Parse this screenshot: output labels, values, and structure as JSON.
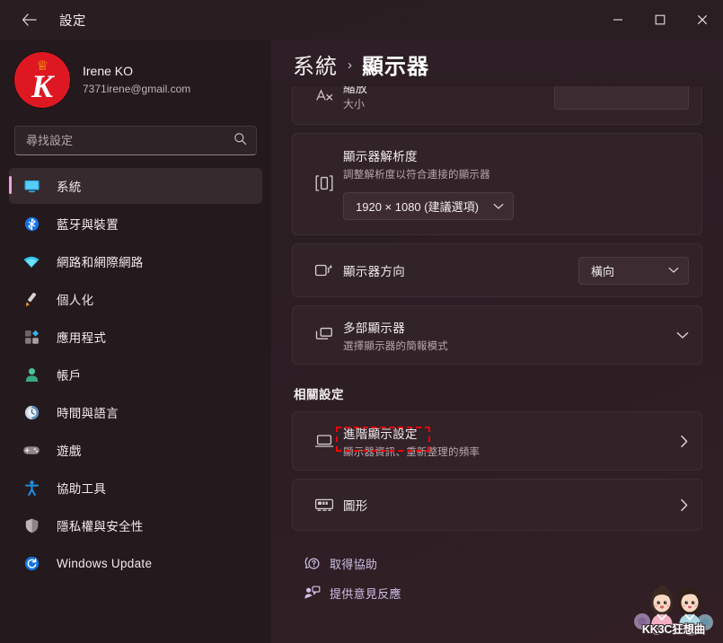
{
  "window": {
    "title": "設定",
    "back_icon": "back-arrow-icon",
    "minimize_label": "—",
    "maximize_label": "□",
    "close_label": "✕"
  },
  "profile": {
    "name": "Irene KO",
    "email": "7371irene@gmail.com",
    "avatar_letter": "K",
    "avatar_crown_icon": "crown-icon",
    "avatar_color": "#dd1822"
  },
  "search": {
    "placeholder": "尋找設定",
    "value": "",
    "icon": "search-icon"
  },
  "sidebar": {
    "accent_color": "#e8a6d8",
    "items": [
      {
        "label": "系統",
        "icon": "monitor-icon",
        "selected": true
      },
      {
        "label": "藍牙與裝置",
        "icon": "bluetooth-icon",
        "selected": false
      },
      {
        "label": "網路和網際網路",
        "icon": "wifi-icon",
        "selected": false
      },
      {
        "label": "個人化",
        "icon": "paintbrush-icon",
        "selected": false
      },
      {
        "label": "應用程式",
        "icon": "apps-grid-icon",
        "selected": false
      },
      {
        "label": "帳戶",
        "icon": "person-icon",
        "selected": false
      },
      {
        "label": "時間與語言",
        "icon": "clock-icon",
        "selected": false
      },
      {
        "label": "遊戲",
        "icon": "gamepad-icon",
        "selected": false
      },
      {
        "label": "協助工具",
        "icon": "accessibility-icon",
        "selected": false
      },
      {
        "label": "隱私權與安全性",
        "icon": "shield-icon",
        "selected": false
      },
      {
        "label": "Windows Update",
        "icon": "update-refresh-icon",
        "selected": false
      }
    ]
  },
  "breadcrumb": {
    "parent": "系統",
    "separator": "›",
    "current": "顯示器"
  },
  "main": {
    "clipped_card": {
      "title_partial": "縮放",
      "subtitle": "大小",
      "icon": "scale-text-icon"
    },
    "resolution_card": {
      "title": "顯示器解析度",
      "subtitle": "調整解析度以符合連接的顯示器",
      "icon": "resolution-icon",
      "selected_value": "1920 × 1080 (建議選項)",
      "chevron": "chevron-down-icon"
    },
    "orientation_card": {
      "title": "顯示器方向",
      "icon": "orientation-icon",
      "selected_value": "橫向",
      "chevron": "chevron-down-icon"
    },
    "multi_display_card": {
      "title": "多部顯示器",
      "subtitle": "選擇顯示器的簡報模式",
      "icon": "multiple-displays-icon",
      "chevron": "chevron-down-icon"
    },
    "related_settings_heading": "相關設定",
    "advanced_card": {
      "title": "進階顯示設定",
      "subtitle": "顯示器資訊、重新整理的頻率",
      "icon": "laptop-display-icon",
      "chevron": "chevron-right-icon",
      "highlighted": true,
      "highlight_color": "#ff0000"
    },
    "graphics_card": {
      "title": "圖形",
      "icon": "graphics-card-icon",
      "chevron": "chevron-right-icon"
    },
    "footer_links": [
      {
        "label": "取得協助",
        "icon": "help-question-icon"
      },
      {
        "label": "提供意見反應",
        "icon": "feedback-icon"
      }
    ]
  },
  "watermark": {
    "caption": "KK3C狂想曲"
  }
}
